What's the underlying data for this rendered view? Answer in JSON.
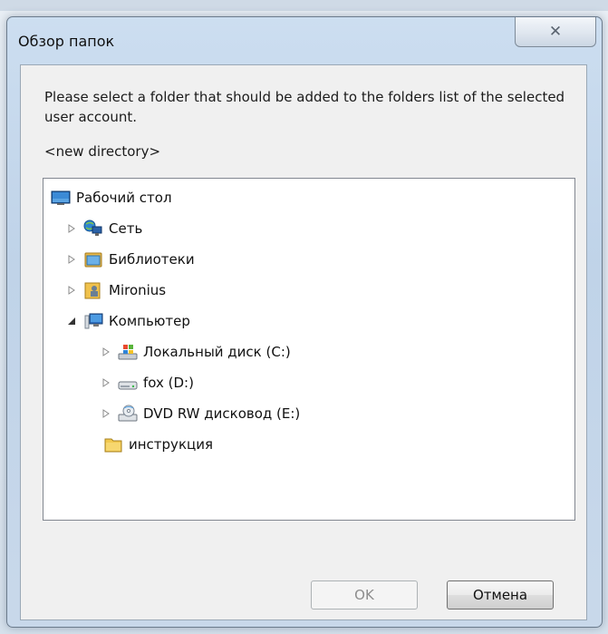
{
  "dialog": {
    "title": "Обзор папок",
    "close_glyph": "✕",
    "instruction": "Please select a folder that should be added to the folders list of the selected user account.",
    "selected_path": "<new directory>"
  },
  "tree": {
    "desktop": "Рабочий стол",
    "network": "Сеть",
    "libraries": "Библиотеки",
    "user": "Mironius",
    "computer": "Компьютер",
    "disk_c": "Локальный диск (C:)",
    "disk_d": "fox (D:)",
    "dvd_e": "DVD RW дисковод (E:)",
    "folder": "инструкция"
  },
  "buttons": {
    "ok": "OK",
    "cancel": "Отмена"
  },
  "colors": {
    "title_bar": "#c8dbef",
    "client_bg": "#f0f0f0",
    "tree_bg": "#ffffff",
    "disabled_text": "#8d8d8d"
  }
}
